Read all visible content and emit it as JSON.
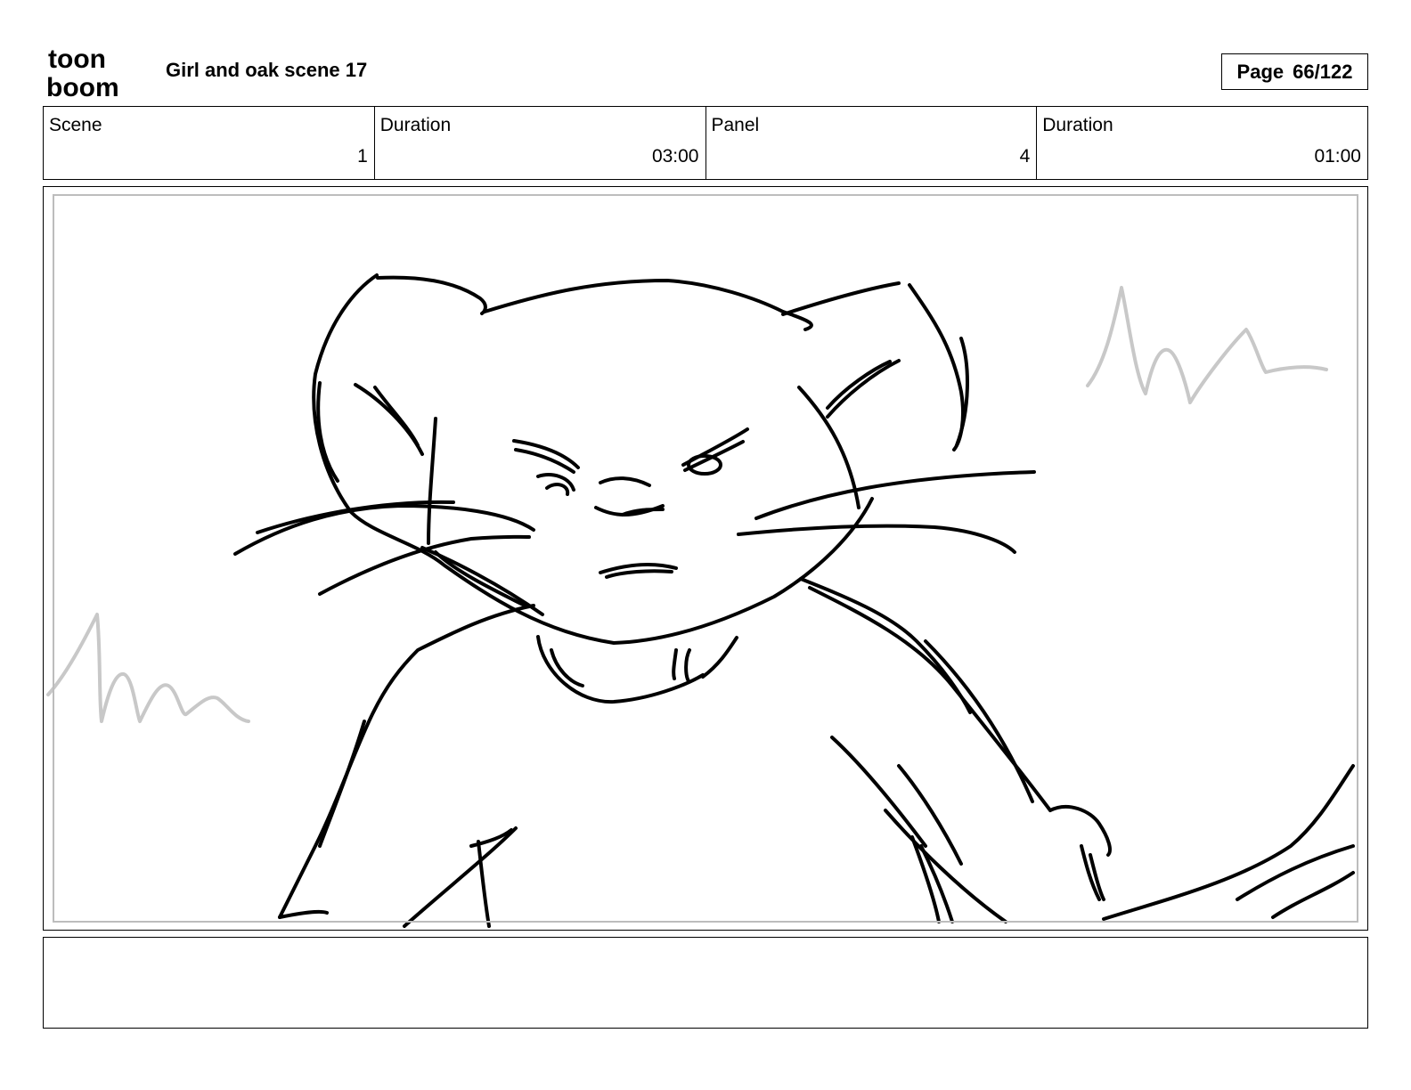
{
  "header": {
    "logo": {
      "line1": "toon",
      "line2": "boom",
      "icon": "toon-boom-logo"
    },
    "title": "Girl and oak scene 17",
    "page_label": "Page",
    "page_value": "66/122"
  },
  "info": {
    "scene_label": "Scene",
    "scene_value": "1",
    "scene_duration_label": "Duration",
    "scene_duration_value": "03:00",
    "panel_label": "Panel",
    "panel_value": "4",
    "panel_duration_label": "Duration",
    "panel_duration_value": "01:00"
  },
  "panel": {
    "image": "rough sketch of a cat face with whiskers looking forward, grass tufts in background",
    "colors": {
      "ink": "#000000",
      "background_sketch": "#c8c8c8",
      "frame_guide": "#bdbdbd"
    }
  },
  "notes": {
    "text": ""
  }
}
